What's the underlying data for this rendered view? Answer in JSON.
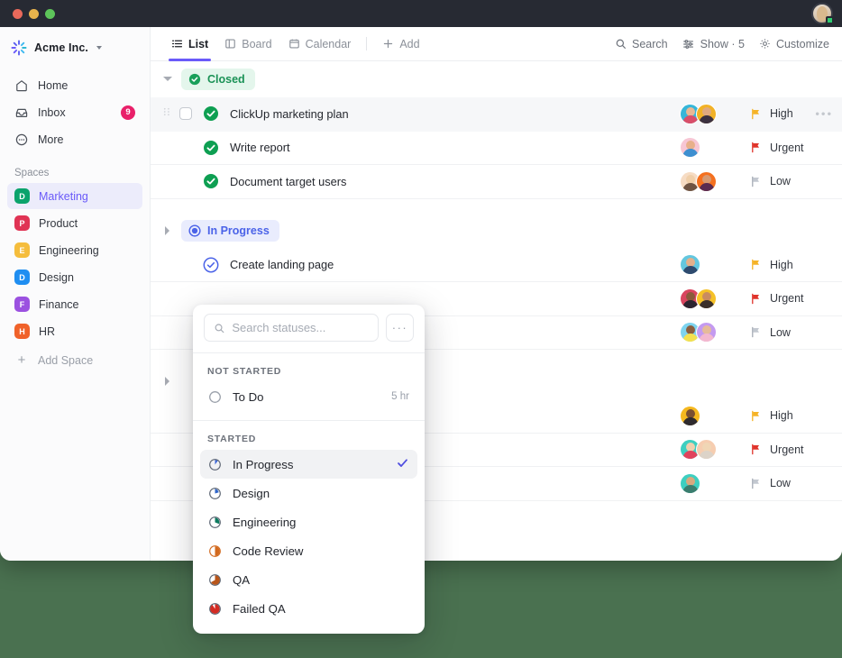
{
  "window": {
    "titlebar": {
      "controls": [
        "close-red",
        "minimize-yellow",
        "maximize-green"
      ],
      "avatar_name": "user-avatar"
    }
  },
  "sidebar": {
    "brand": {
      "name": "Acme Inc.",
      "logo": "clickup-starburst-icon"
    },
    "nav": [
      {
        "label": "Home",
        "icon": "home-icon",
        "badge": ""
      },
      {
        "label": "Inbox",
        "icon": "inbox-icon",
        "badge": "9"
      },
      {
        "label": "More",
        "icon": "more-circle-icon",
        "badge": ""
      }
    ],
    "spaces_label": "Spaces",
    "spaces": [
      {
        "label": "Marketing",
        "initial": "D",
        "color": "#0ba36c",
        "active": true
      },
      {
        "label": "Product",
        "initial": "P",
        "color": "#e03354",
        "active": false
      },
      {
        "label": "Engineering",
        "initial": "E",
        "color": "#f5bd3c",
        "active": false
      },
      {
        "label": "Design",
        "initial": "D",
        "color": "#1f8ef1",
        "active": false
      },
      {
        "label": "Finance",
        "initial": "F",
        "color": "#9b51e0",
        "active": false
      },
      {
        "label": "HR",
        "initial": "H",
        "color": "#f0622a",
        "active": false
      }
    ],
    "add_space": {
      "label": "Add Space",
      "icon": "plus-icon"
    }
  },
  "toolbar": {
    "tabs": [
      {
        "label": "List",
        "icon": "list-icon",
        "active": true
      },
      {
        "label": "Board",
        "icon": "board-icon",
        "active": false
      },
      {
        "label": "Calendar",
        "icon": "calendar-icon",
        "active": false
      }
    ],
    "add": {
      "label": "Add",
      "icon": "plus-icon"
    },
    "right": [
      {
        "label": "Search",
        "icon": "search-icon"
      },
      {
        "label": "Show · 5",
        "icon": "sliders-icon"
      },
      {
        "label": "Customize",
        "icon": "gear-icon"
      }
    ]
  },
  "list": {
    "groups": [
      {
        "name": "Closed",
        "chip_class": "closed",
        "expanded": true,
        "icon": "check-circle-filled-icon",
        "tasks": [
          {
            "title": "ClickUp marketing plan",
            "status_icon": "check-circle-green-icon",
            "priority": "High",
            "priority_color": "#f5b327",
            "hovered": true,
            "has_checkbox": true,
            "avatars": [
              {
                "bg": "#36b6d9",
                "head": "#e8b894",
                "body": "#d94f6a"
              },
              {
                "bg": "#f2b227",
                "head": "#e0a97f",
                "body": "#3c3140"
              }
            ]
          },
          {
            "title": "Write report",
            "status_icon": "check-circle-green-icon",
            "priority": "Urgent",
            "priority_color": "#e0342b",
            "hovered": false,
            "has_checkbox": false,
            "avatars": [
              {
                "bg": "#f7c6d4",
                "head": "#e8b08a",
                "body": "#3e8fd0"
              }
            ]
          },
          {
            "title": "Document target users",
            "status_icon": "check-circle-green-icon",
            "priority": "Low",
            "priority_color": "#a5abb5",
            "hovered": false,
            "has_checkbox": false,
            "avatars": [
              {
                "bg": "#f6dcc4",
                "head": "#f0cfa9",
                "body": "#6f5443"
              },
              {
                "bg": "#f4701f",
                "head": "#d79a72",
                "body": "#5a2b50"
              }
            ]
          }
        ]
      },
      {
        "name": "In Progress",
        "chip_class": "inprog",
        "expanded": false,
        "icon": "progress-circle-icon",
        "tasks": [
          {
            "title": "Create landing page",
            "status_icon": "check-circle-blue-outline-icon",
            "priority": "High",
            "priority_color": "#f5b327",
            "hovered": false,
            "has_checkbox": false,
            "avatars": [
              {
                "bg": "#63c7df",
                "head": "#e3b08b",
                "body": "#2e4a6e"
              }
            ]
          },
          {
            "title": "",
            "status_icon": "",
            "priority": "Urgent",
            "priority_color": "#e0342b",
            "hovered": false,
            "has_checkbox": false,
            "avatars": [
              {
                "bg": "#d9455f",
                "head": "#8a5a3c",
                "body": "#2c2430"
              },
              {
                "bg": "#f5c128",
                "head": "#c98b60",
                "body": "#3a2f2a"
              }
            ]
          },
          {
            "title": "",
            "status_icon": "",
            "priority": "Low",
            "priority_color": "#a5abb5",
            "hovered": false,
            "has_checkbox": false,
            "avatars": [
              {
                "bg": "#7ed4ef",
                "head": "#8a5e3f",
                "body": "#f3e04f"
              },
              {
                "bg": "#c49af0",
                "head": "#e6bb99",
                "body": "#f3b8cf"
              }
            ]
          }
        ]
      },
      {
        "name": "",
        "chip_class": "inprog",
        "expanded": false,
        "icon": "",
        "tasks": [
          {
            "title": "",
            "status_icon": "",
            "priority": "High",
            "priority_color": "#f5b327",
            "hovered": false,
            "has_checkbox": false,
            "avatars": [
              {
                "bg": "#f5b81f",
                "head": "#7a4f31",
                "body": "#2e2a2e"
              }
            ]
          },
          {
            "title": "",
            "status_icon": "",
            "priority": "Urgent",
            "priority_color": "#e0342b",
            "hovered": false,
            "has_checkbox": false,
            "avatars": [
              {
                "bg": "#3ecfc0",
                "head": "#f0d0ae",
                "body": "#e0435c"
              },
              {
                "bg": "#f6cdb0",
                "head": "#f0d6b5",
                "body": "#dcd3c8"
              }
            ]
          },
          {
            "title": "",
            "status_icon": "",
            "priority": "Low",
            "priority_color": "#a5abb5",
            "hovered": false,
            "has_checkbox": false,
            "avatars": [
              {
                "bg": "#3ecfc0",
                "head": "#d8a87f",
                "body": "#3a7d6e"
              }
            ]
          }
        ]
      }
    ]
  },
  "status_dropdown": {
    "search_placeholder": "Search statuses...",
    "search_value": "",
    "search_icon": "search-icon",
    "more_button": "···",
    "groups": [
      {
        "label": "NOT STARTED",
        "items": [
          {
            "label": "To Do",
            "meta": "5 hr",
            "selected": false,
            "icon": "status-empty-circle",
            "color": "#9aa0aa",
            "fill": 0
          }
        ]
      },
      {
        "label": "STARTED",
        "items": [
          {
            "label": "In Progress",
            "meta": "",
            "selected": true,
            "icon": "status-pie-icon",
            "color": "#3a66d8",
            "fill": 15
          },
          {
            "label": "Design",
            "meta": "",
            "selected": false,
            "icon": "status-pie-icon",
            "color": "#2e64c8",
            "fill": 28
          },
          {
            "label": "Engineering",
            "meta": "",
            "selected": false,
            "icon": "status-pie-icon",
            "color": "#0e7a5f",
            "fill": 42
          },
          {
            "label": "Code Review",
            "meta": "",
            "selected": false,
            "icon": "status-pie-icon",
            "color": "#d2691e",
            "fill": 50
          },
          {
            "label": "QA",
            "meta": "",
            "selected": false,
            "icon": "status-pie-icon",
            "color": "#b8551a",
            "fill": 68
          },
          {
            "label": "Failed QA",
            "meta": "",
            "selected": false,
            "icon": "status-pie-icon",
            "color": "#d32b23",
            "fill": 85
          }
        ]
      }
    ],
    "check_color": "#4f4ee0"
  },
  "desktop": {
    "background_color": "#4a7150"
  }
}
